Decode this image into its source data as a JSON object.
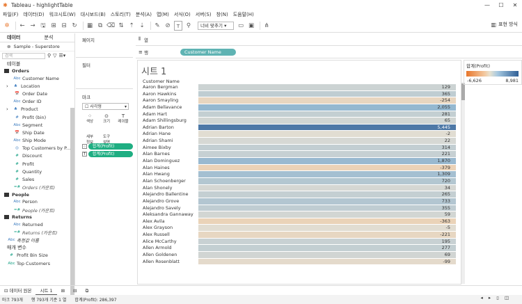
{
  "window": {
    "title": "Tableau - highlightTable",
    "logo_icon": "tableau-logo-icon"
  },
  "menu": [
    "파일(F)",
    "데이터(D)",
    "워크시트(W)",
    "대시보드(B)",
    "스토리(T)",
    "분석(A)",
    "맵(M)",
    "서식(O)",
    "서버(S)",
    "창(N)",
    "도움말(H)"
  ],
  "toolbar": {
    "fit_label": "너비 맞추기",
    "present_label": "표현 방식"
  },
  "left": {
    "tab_data": "데이터",
    "tab_analysis": "분석",
    "source": "Sample - Superstore",
    "search_placeholder": "검색",
    "tables_heading": "테이블",
    "groups": [
      {
        "name": "Orders",
        "fields": [
          {
            "icon": "Abc",
            "name": "Customer Name",
            "t": "dim"
          },
          {
            "icon": "♣",
            "name": "Location",
            "t": "dim",
            "arrow": true
          },
          {
            "icon": "📅",
            "name": "Order Date",
            "t": "dim"
          },
          {
            "icon": "Abc",
            "name": "Order ID",
            "t": "dim"
          },
          {
            "icon": "♣",
            "name": "Product",
            "t": "dim",
            "arrow": true
          },
          {
            "icon": "#",
            "name": "Profit (bin)",
            "t": "dim"
          },
          {
            "icon": "Abc",
            "name": "Segment",
            "t": "dim"
          },
          {
            "icon": "📅",
            "name": "Ship Date",
            "t": "dim"
          },
          {
            "icon": "Abc",
            "name": "Ship Mode",
            "t": "dim"
          },
          {
            "icon": "◎",
            "name": "Top Customers by P...",
            "t": "dim"
          },
          {
            "icon": "#",
            "name": "Discount",
            "t": "mea"
          },
          {
            "icon": "#",
            "name": "Profit",
            "t": "mea"
          },
          {
            "icon": "#",
            "name": "Quantity",
            "t": "mea"
          },
          {
            "icon": "#",
            "name": "Sales",
            "t": "mea"
          },
          {
            "icon": "=#",
            "name": "Orders (카운트)",
            "t": "mea",
            "italic": true
          }
        ]
      },
      {
        "name": "People",
        "fields": [
          {
            "icon": "Abc",
            "name": "Person",
            "t": "dim"
          },
          {
            "icon": "=#",
            "name": "People (카운트)",
            "t": "mea",
            "italic": true
          }
        ]
      },
      {
        "name": "Returns",
        "fields": [
          {
            "icon": "Abc",
            "name": "Returned",
            "t": "dim"
          },
          {
            "icon": "=#",
            "name": "Returns (카운트)",
            "t": "mea",
            "italic": true
          }
        ]
      }
    ],
    "extra_field": {
      "icon": "Abc",
      "name": "측정값 이름"
    },
    "params_heading": "매개 변수",
    "params": [
      {
        "icon": "#",
        "name": "Profit Bin Size"
      },
      {
        "icon": "Abc",
        "name": "Top Customers"
      }
    ]
  },
  "mid": {
    "pages": "페이지",
    "filters": "필터",
    "marks": "마크",
    "mark_type": "사각형",
    "buttons": [
      {
        "icon": "⁘",
        "label": "색상"
      },
      {
        "icon": "⊙",
        "label": "크기"
      },
      {
        "icon": "T",
        "label": "레이블"
      },
      {
        "icon": "",
        "label": "세부\n정보"
      },
      {
        "icon": "",
        "label": "도구\n설명"
      }
    ],
    "pills": [
      {
        "icon": "⁘",
        "text": "합계(Profit)"
      },
      {
        "icon": "T",
        "text": "합계(Profit)"
      }
    ]
  },
  "shelves": {
    "columns": "열",
    "rows": "행",
    "row_pill": "Customer Name"
  },
  "sheet": {
    "title": "시트 1",
    "col_header": "Customer Name"
  },
  "rows": [
    [
      "Aaron Bergman",
      "129"
    ],
    [
      "Aaron Hawkins",
      "365"
    ],
    [
      "Aaron Smayling",
      "-254"
    ],
    [
      "Adam Bellavance",
      "2,055"
    ],
    [
      "Adam Hart",
      "281"
    ],
    [
      "Adam Shillingsburg",
      "65"
    ],
    [
      "Adrian Barton",
      "5,445"
    ],
    [
      "Adrian Hane",
      "-2"
    ],
    [
      "Adrian Shami",
      "22"
    ],
    [
      "Aimee Bixby",
      "314"
    ],
    [
      "Alan Barnes",
      "221"
    ],
    [
      "Alan Dominguez",
      "1,870"
    ],
    [
      "Alan Haines",
      "-379"
    ],
    [
      "Alan Hwang",
      "1,309"
    ],
    [
      "Alan Schoenberger",
      "720"
    ],
    [
      "Alan Shonely",
      "34"
    ],
    [
      "Alejandro Ballentine",
      "265"
    ],
    [
      "Alejandro Grove",
      "733"
    ],
    [
      "Alejandro Savely",
      "355"
    ],
    [
      "Aleksandra Gannaway",
      "59"
    ],
    [
      "Alex Avila",
      "-363"
    ],
    [
      "Alex Grayson",
      "-5"
    ],
    [
      "Alex Russell",
      "-221"
    ],
    [
      "Alice McCarthy",
      "195"
    ],
    [
      "Allen Armold",
      "277"
    ],
    [
      "Allen Goldenen",
      "69"
    ],
    [
      "Allen Rosenblatt",
      "-99"
    ]
  ],
  "selected_row": "Adrian Barton",
  "legend": {
    "title": "합계(Profit)",
    "min": "-6,626",
    "max": "8,981",
    "min_color": "#e8762b",
    "max_color": "#2f5f96"
  },
  "tabs": {
    "source": "데이터 원본",
    "sheet": "시트 1"
  },
  "status": {
    "marks": "마크 793개",
    "rows": "행 793개 기준 1 열",
    "sum": "합계(Profit): 286,397"
  }
}
